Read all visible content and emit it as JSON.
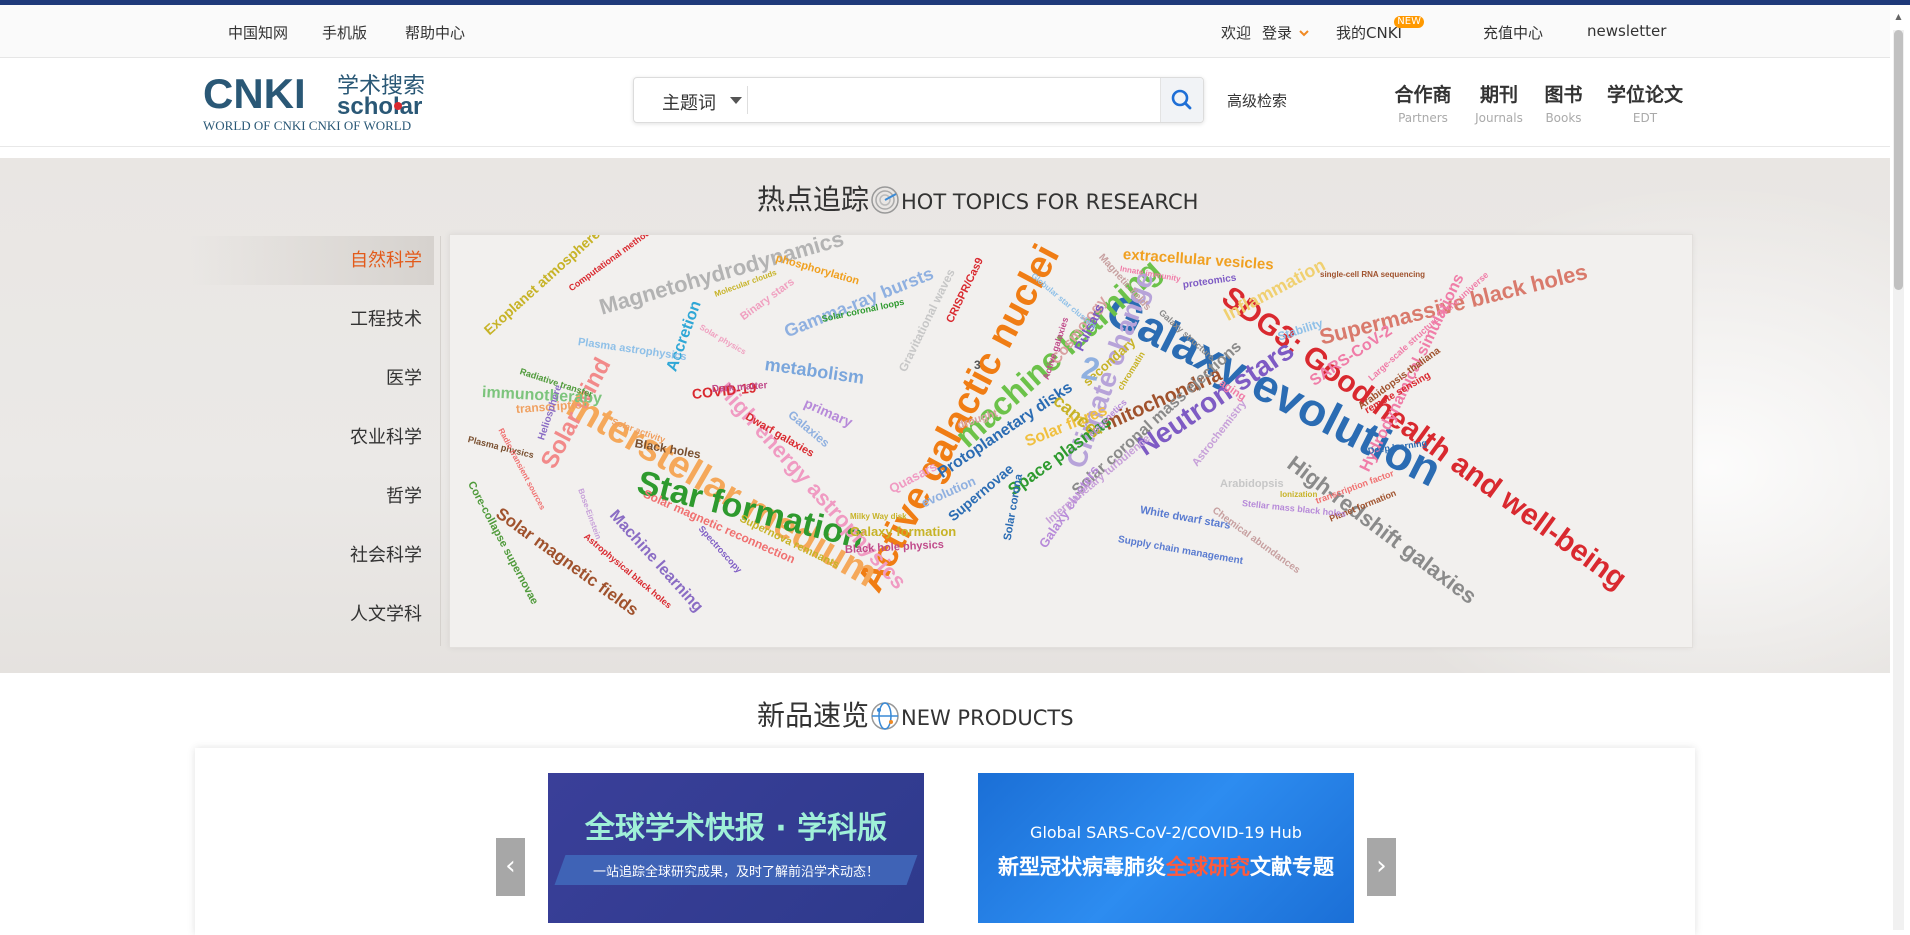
{
  "topbar": {
    "links": [
      "中国知网",
      "手机版",
      "帮助中心"
    ],
    "welcome": "欢迎",
    "login": "登录",
    "my_cnki": "我的CNKI",
    "new_badge": "NEW",
    "recharge": "充值中心",
    "newsletter": "newsletter"
  },
  "header": {
    "logo_main": "CNKI",
    "logo_cn": "学术搜索",
    "logo_sub": "scholar",
    "logo_tagline": "WORLD OF CNKI CNKI OF WORLD",
    "search_scope": "主题词",
    "search_value": "",
    "advanced": "高级检索",
    "nav": [
      {
        "zh": "合作商",
        "en": "Partners"
      },
      {
        "zh": "期刊",
        "en": "Journals"
      },
      {
        "zh": "图书",
        "en": "Books"
      },
      {
        "zh": "学位论文",
        "en": "EDT"
      }
    ]
  },
  "hot": {
    "title_cn": "热点追踪",
    "title_en": "HOT TOPICS FOR RESEARCH",
    "categories": [
      "自然科学",
      "工程技术",
      "医学",
      "农业科学",
      "哲学",
      "社会科学",
      "人文学科"
    ],
    "active_category": "自然科学",
    "words": [
      {
        "text": "Galaxy evolution",
        "color": "#2b6cb3"
      },
      {
        "text": "SDG3: Good health and well-being",
        "color": "#d9292f"
      },
      {
        "text": "Active galactic nuclei",
        "color": "#f07d14"
      },
      {
        "text": "Interstellar medium",
        "color": "#f5a85a"
      },
      {
        "text": "Star formation",
        "color": "#2e9a2e"
      },
      {
        "text": "machine learning",
        "color": "#6cc24a"
      },
      {
        "text": "Climate change",
        "color": "#b7a3d9"
      },
      {
        "text": "Neutron stars",
        "color": "#7e5bc4"
      },
      {
        "text": "Supermassive black holes",
        "color": "#d97a6c"
      },
      {
        "text": "High-redshift galaxies",
        "color": "#8a8a8a"
      },
      {
        "text": "Magnetohydrodynamics",
        "color": "#b3b3b3"
      },
      {
        "text": "High energy astrophysics",
        "color": "#f09ac2"
      },
      {
        "text": "Gamma-ray bursts",
        "color": "#8fb0e0"
      },
      {
        "text": "metabolism",
        "color": "#7aa6dc"
      },
      {
        "text": "mitochondria",
        "color": "#a0522d"
      },
      {
        "text": "Solar wind",
        "color": "#f28a8a"
      },
      {
        "text": "Solar magnetic fields",
        "color": "#a0522d"
      },
      {
        "text": "Machine learning",
        "color": "#8a6cc4"
      },
      {
        "text": "Solar coronal mass ejections",
        "color": "#8a8a8a"
      },
      {
        "text": "Hydrodynamical simulations",
        "color": "#f07da8"
      },
      {
        "text": "Exoplanet atmospheres",
        "color": "#c7b327"
      },
      {
        "text": "immunotherapy",
        "color": "#7cc47c"
      },
      {
        "text": "extracellular vesicles",
        "color": "#f0a020"
      },
      {
        "text": "Protoplanetary disks",
        "color": "#2b6cb3"
      },
      {
        "text": "Space plasmas",
        "color": "#2e9a2e"
      },
      {
        "text": "Solar flares",
        "color": "#f0c040"
      },
      {
        "text": "Cosmology",
        "color": "#d9a0a0"
      },
      {
        "text": "cancer",
        "color": "#c7b327"
      },
      {
        "text": "Accretion",
        "color": "#2fa7d6"
      },
      {
        "text": "Inflammation",
        "color": "#f0d070"
      },
      {
        "text": "SARS-CoV-2",
        "color": "#f07da8"
      },
      {
        "text": "COVID-19",
        "color": "#d9292f"
      },
      {
        "text": "Galaxy clusters",
        "color": "#b78ad9"
      },
      {
        "text": "Galaxy formation",
        "color": "#c7b327"
      },
      {
        "text": "Black holes",
        "color": "#7a5030"
      },
      {
        "text": "transcription",
        "color": "#f0a060"
      },
      {
        "text": "Core-collapse supernovae",
        "color": "#4f9a3a"
      },
      {
        "text": "Solar magnetic reconnection",
        "color": "#f07070"
      },
      {
        "text": "Supernova remnants",
        "color": "#c7b327"
      },
      {
        "text": "Gravitational waves",
        "color": "#c7c7c7"
      },
      {
        "text": "Pulsars",
        "color": "#7e5bc4"
      },
      {
        "text": "White dwarf stars",
        "color": "#5a7bd0"
      },
      {
        "text": "Astrochemistry",
        "color": "#c7a0d9"
      },
      {
        "text": "Interplanetary turbulence",
        "color": "#c7a0d9"
      },
      {
        "text": "Solar corona",
        "color": "#2b6cb3"
      },
      {
        "text": "Plasma astrophysics",
        "color": "#8fc0e8"
      },
      {
        "text": "Black hole physics",
        "color": "#c04a8a"
      },
      {
        "text": "Dwarf galaxies",
        "color": "#d9292f"
      },
      {
        "text": "Quasars",
        "color": "#f09ac2"
      },
      {
        "text": "evolution",
        "color": "#8fb0e0"
      },
      {
        "text": "primary",
        "color": "#b78ad9"
      },
      {
        "text": "secondary",
        "color": "#c7b327"
      },
      {
        "text": "phosphorylation",
        "color": "#f0a020"
      },
      {
        "text": "Heliosphere",
        "color": "#8a6cc4"
      },
      {
        "text": "Stability",
        "color": "#8fc0e8"
      },
      {
        "text": "aging",
        "color": "#f07da8"
      },
      {
        "text": "proteomics",
        "color": "#7e5bc4"
      },
      {
        "text": "Chemical abundances",
        "color": "#c7a0a0"
      },
      {
        "text": "Arabidopsis thaliana",
        "color": "#a0522d"
      },
      {
        "text": "Supply chain management",
        "color": "#5a7bd0"
      },
      {
        "text": "remote sensing",
        "color": "#d9292f"
      },
      {
        "text": "Deep learning",
        "color": "#2b6cb3"
      },
      {
        "text": "Planet formation",
        "color": "#a0522d"
      },
      {
        "text": "Stellar mass black holes",
        "color": "#b78ad9"
      },
      {
        "text": "Arabidopsis",
        "color": "#c7c7c7"
      },
      {
        "text": "epigenetics",
        "color": "#b78ad9"
      },
      {
        "text": "drought",
        "color": "#d9a0a0"
      },
      {
        "text": "chromatin",
        "color": "#c7b327"
      },
      {
        "text": "Binary stars",
        "color": "#f0a0c0"
      },
      {
        "text": "Solar coronal loops",
        "color": "#2e9a2e"
      },
      {
        "text": "Dark matter",
        "color": "#c04a8a"
      },
      {
        "text": "Galaxies",
        "color": "#8fb0e0"
      },
      {
        "text": "Solar activity",
        "color": "#f0a060"
      },
      {
        "text": "Plasma physics",
        "color": "#7a5030"
      },
      {
        "text": "CRISPR/Cas9",
        "color": "#d9292f"
      },
      {
        "text": "Computational methods",
        "color": "#d9292f"
      },
      {
        "text": "Radiative transfer",
        "color": "#4f9a3a"
      },
      {
        "text": "Molecular clouds",
        "color": "#c7b327"
      },
      {
        "text": "Astrophysical black holes",
        "color": "#d9292f"
      },
      {
        "text": "Radio transient sources",
        "color": "#f07070"
      },
      {
        "text": "Spectroscopy",
        "color": "#7e5bc4"
      },
      {
        "text": "Bose-Einstein",
        "color": "#c7a0d9"
      },
      {
        "text": "Ionization",
        "color": "#c7b327"
      },
      {
        "text": "Large-scale structure of the universe",
        "color": "#f07da8"
      },
      {
        "text": "Galaxy structure",
        "color": "#8a8a8a"
      },
      {
        "text": "Magnetic fields",
        "color": "#c7a0a0"
      },
      {
        "text": "single-cell RNA sequencing",
        "color": "#a0522d"
      },
      {
        "text": "Innate immunity",
        "color": "#f07da8"
      },
      {
        "text": "Solar physics",
        "color": "#f0a0c0"
      },
      {
        "text": "Globular star clusters",
        "color": "#8fc0e8"
      },
      {
        "text": "Milky Way disk",
        "color": "#c7b327"
      },
      {
        "text": "Active galaxies",
        "color": "#c04a8a"
      },
      {
        "text": "transcription factor",
        "color": "#f07070"
      },
      {
        "text": "Supernovae",
        "color": "#2b6cb3"
      },
      {
        "text": "2",
        "color": "#8fb0e0"
      },
      {
        "text": "3",
        "color": "#555555"
      }
    ]
  },
  "products": {
    "title_cn": "新品速览",
    "title_en": "NEW PRODUCTS",
    "banner1_title": "全球学术快报 · 学科版",
    "banner1_sub": "一站追踪全球研究成果，及时了解前沿学术动态！",
    "banner2_line1": "Global SARS-CoV-2/COVID-19 Hub",
    "banner2_pre": "新型冠状病毒肺炎",
    "banner2_hl": "全球研究",
    "banner2_post": "文献专题",
    "prev": "‹",
    "next": "›"
  }
}
